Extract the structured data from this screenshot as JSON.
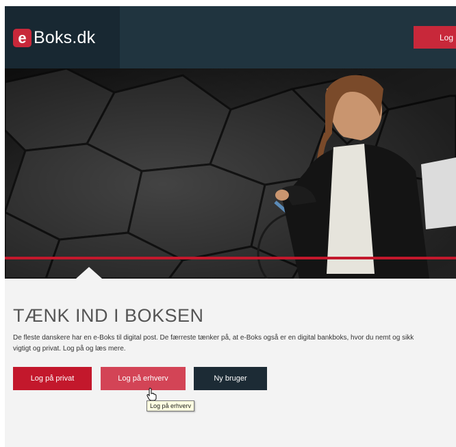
{
  "header": {
    "logo_mark": "e",
    "logo_text": "Boks.dk",
    "login_label": "Log på"
  },
  "hero": {
    "image": "woman-with-bicycle-photo"
  },
  "content": {
    "headline": "TÆNK IND I BOKSEN",
    "intro": "De fleste danskere har en e-Boks til digital post. De færreste tænker på, at e-Boks også er en digital bankboks, hvor du nemt og sikk\nvigtigt og privat. Log på og læs mere."
  },
  "buttons": {
    "private": "Log på privat",
    "business": "Log på erhverv",
    "new_user": "Ny bruger"
  },
  "tooltip": "Log på erhverv",
  "colors": {
    "brand_red": "#c3182c",
    "header_dark": "#20343f",
    "logo_panel": "#182832",
    "hover_red": "#d34456",
    "dark_button": "#1c2b35"
  },
  "icons": {
    "cursor": "hand-pointer-icon"
  }
}
